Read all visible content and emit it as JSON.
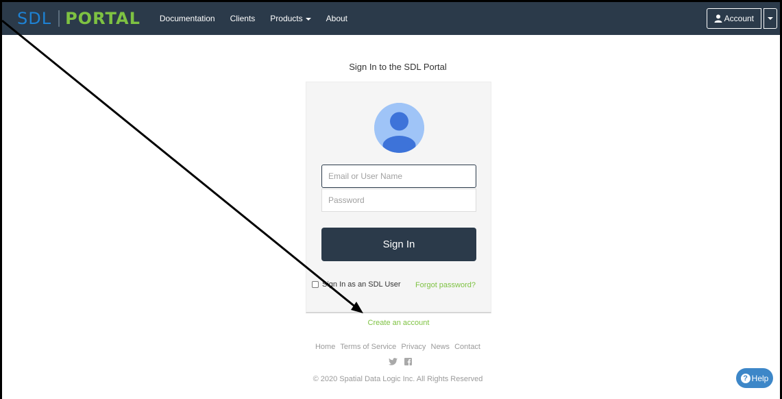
{
  "navbar": {
    "brand_left": "SDL",
    "brand_right": "PORTAL",
    "links": {
      "documentation": "Documentation",
      "clients": "Clients",
      "products": "Products",
      "about": "About"
    },
    "account_label": "Account"
  },
  "signin": {
    "page_title": "Sign In to the SDL Portal",
    "email_placeholder": "Email or User Name",
    "password_placeholder": "Password",
    "button_label": "Sign In",
    "sdl_user_label": "Sign In as an SDL User",
    "forgot_label": "Forgot password?",
    "create_account_label": "Create an account"
  },
  "footer": {
    "links": {
      "home": "Home",
      "terms": "Terms of Service",
      "privacy": "Privacy",
      "news": "News",
      "contact": "Contact"
    },
    "copyright": "© 2020 Spatial Data Logic Inc. All Rights Reserved"
  },
  "help": {
    "label": "Help"
  },
  "icons": {
    "user": "user-icon",
    "caret": "caret-down-icon",
    "twitter": "twitter-icon",
    "facebook": "facebook-icon",
    "help": "question-circle-icon"
  },
  "colors": {
    "navbar_bg": "#2b3a4a",
    "brand_blue": "#1e82d4",
    "brand_green": "#7ec242",
    "help_blue": "#3d87c8",
    "avatar_light": "#9fc4f7",
    "avatar_dark": "#3d73d9"
  }
}
